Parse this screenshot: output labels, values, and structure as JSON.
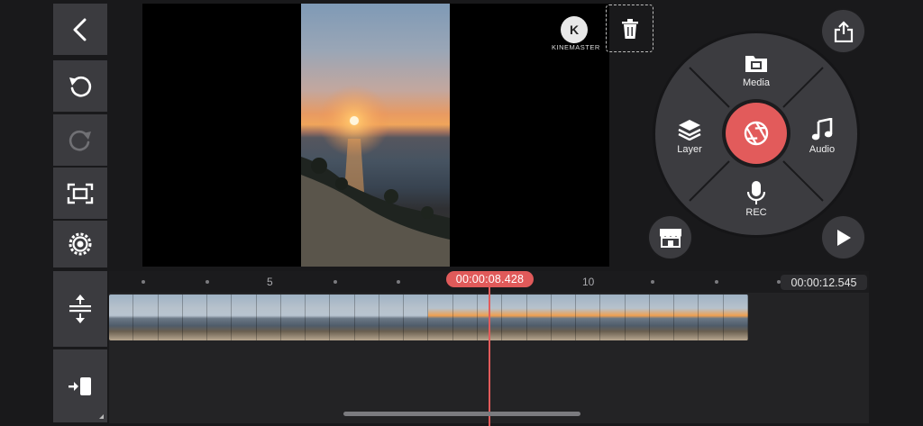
{
  "toolbar_left": {
    "items": [
      {
        "name": "back-button",
        "icon": "chevron-left-icon",
        "enabled": true
      },
      {
        "name": "undo-button",
        "icon": "undo-icon",
        "enabled": true
      },
      {
        "name": "redo-button",
        "icon": "redo-icon",
        "enabled": false
      },
      {
        "name": "fullscreen-button",
        "icon": "fullscreen-icon",
        "enabled": true
      },
      {
        "name": "settings-button",
        "icon": "gear-icon",
        "enabled": true
      }
    ],
    "timeline_buttons": [
      {
        "name": "expand-tracks-button",
        "icon": "expand-vertical-icon"
      },
      {
        "name": "jump-to-start-button",
        "icon": "jump-to-start-icon"
      }
    ]
  },
  "preview": {
    "watermark": {
      "letter": "K",
      "text": "KINEMASTER"
    },
    "delete_icon": "trash-icon"
  },
  "wheel": {
    "media_label": "Media",
    "layer_label": "Layer",
    "audio_label": "Audio",
    "rec_label": "REC",
    "center_icon": "camera-shutter-icon",
    "center_color": "#e25b5b"
  },
  "actions": {
    "share_icon": "share-icon",
    "store_icon": "store-icon",
    "play_icon": "play-icon"
  },
  "timeline": {
    "ruler_labels": [
      "5",
      "10"
    ],
    "current_time": "00:00:08.428",
    "total_time": "00:00:12.545",
    "accent": "#e25b5b"
  }
}
